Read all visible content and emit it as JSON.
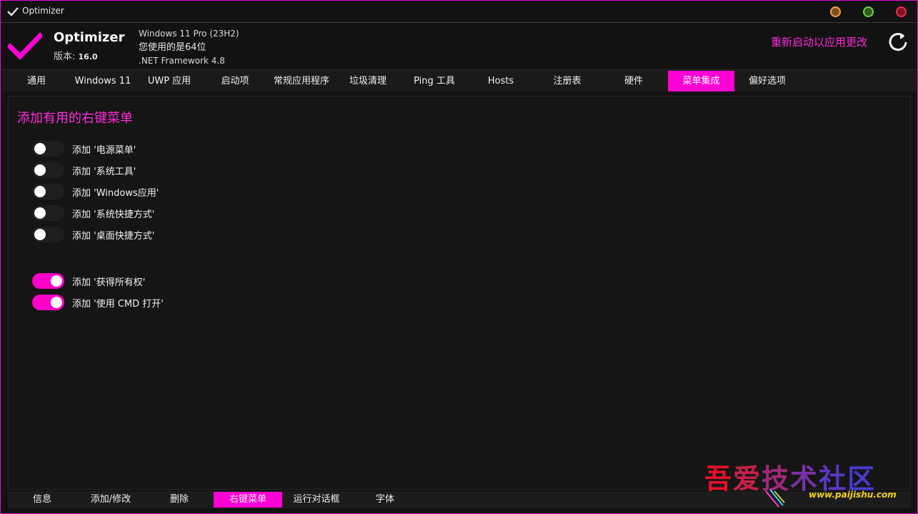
{
  "window": {
    "title": "Optimizer",
    "accent": "#ff00d4"
  },
  "header": {
    "app_name": "Optimizer",
    "version_label": "版本: ",
    "version_number": "16.0",
    "os": "Windows 11 Pro (23H2)",
    "bits_text": "您使用的是64位",
    "framework": ".NET Framework 4.8",
    "restart_text": "重新启动以应用更改"
  },
  "tabs": [
    {
      "label": "通用"
    },
    {
      "label": "Windows 11"
    },
    {
      "label": "UWP 应用"
    },
    {
      "label": "启动项"
    },
    {
      "label": "常规应用程序"
    },
    {
      "label": "垃圾清理"
    },
    {
      "label": "Ping 工具"
    },
    {
      "label": "Hosts"
    },
    {
      "label": "注册表"
    },
    {
      "label": "硬件"
    },
    {
      "label": "菜单集成"
    },
    {
      "label": "偏好选项"
    }
  ],
  "active_tab": "菜单集成",
  "content": {
    "section_title": "添加有用的右键菜单",
    "toggles": [
      {
        "label": "添加 '电源菜单'",
        "on": false
      },
      {
        "label": "添加 '系统工具'",
        "on": false
      },
      {
        "label": "添加 'Windows应用'",
        "on": false
      },
      {
        "label": "添加 '系统快捷方式'",
        "on": false
      },
      {
        "label": "添加 '桌面快捷方式'",
        "on": false
      },
      {
        "label": "添加 '获得所有权'",
        "on": true
      },
      {
        "label": "添加 '使用 CMD 打开'",
        "on": true
      }
    ]
  },
  "bottom_tabs": [
    {
      "label": "信息"
    },
    {
      "label": "添加/修改"
    },
    {
      "label": "删除"
    },
    {
      "label": "右键菜单"
    },
    {
      "label": "运行对话框"
    },
    {
      "label": "字体"
    }
  ],
  "active_bottom_tab": "右键菜单",
  "watermark": {
    "chars": [
      "吾",
      "爱",
      "技",
      "术",
      "社",
      "区"
    ],
    "url": "www.paijishu.com"
  }
}
